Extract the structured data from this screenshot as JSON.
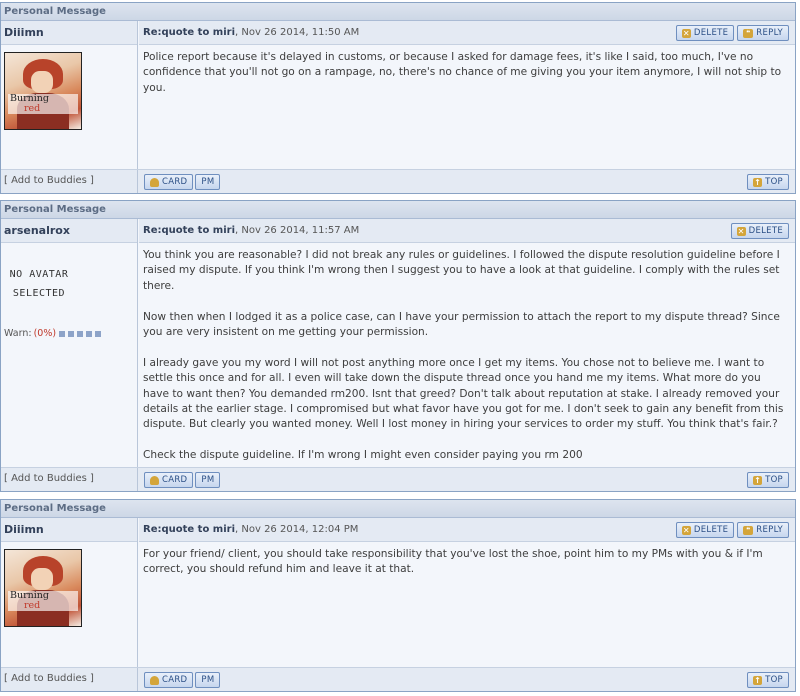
{
  "section_header": "Personal Message",
  "buttons": {
    "delete": "DELETE",
    "reply": "REPLY",
    "card": "CARD",
    "pm": "PM",
    "top": "TOP"
  },
  "add_buddies": "[ Add to Buddies ]",
  "posts": [
    {
      "author": "Diiimn",
      "subject": "Re:quote to miri",
      "date": ", Nov 26 2014, 11:50 AM",
      "avatar_caption_1": "Burning",
      "avatar_caption_2": "red",
      "paragraphs": [
        "Police report because it's delayed in customs, or because I asked for damage fees, it's like I said, too much, I've no confidence that you'll not go on a rampage, no, there's no chance of me giving you your item anymore, I will not ship to you."
      ]
    },
    {
      "author": "arsenalrox",
      "subject": "Re:quote to miri",
      "date": ", Nov 26 2014, 11:57 AM",
      "no_avatar": "NO AVATAR SELECTED",
      "warn_label": "Warn:",
      "warn_value": "(0%)",
      "paragraphs": [
        "You think you are reasonable? I did not break any rules or guidelines. I followed the dispute resolution guideline before I raised my dispute. If you think I'm wrong then I suggest you to have a look at that guideline. I comply with the rules set there.",
        "Now then when I lodged it as a police case, can I have your permission to attach the report to my dispute thread? Since you are very insistent on me getting your permission.",
        "I already gave you my word I will not post anything more once I get my items. You chose not to believe me. I want to settle this once and for all. I even will take down the dispute thread once you hand me my items. What more do you have to want then? You demanded rm200. Isnt that greed? Don't talk about reputation at stake. I already removed your details at the earlier stage. I compromised but what favor have you got for me. I don't seek to gain any benefit from this dispute. But clearly you wanted money. Well I lost money in hiring your services to order my stuff. You think that's fair.?",
        "Check the dispute guideline. If I'm wrong I might even consider paying you rm 200"
      ]
    },
    {
      "author": "Diiimn",
      "subject": "Re:quote to miri",
      "date": ", Nov 26 2014, 12:04 PM",
      "avatar_caption_1": "Burning",
      "avatar_caption_2": "red",
      "paragraphs": [
        "For your friend/ client, you should take responsibility that you've lost the shoe, point him to my PMs with you & if I'm correct, you should refund him and leave it at that."
      ]
    }
  ]
}
